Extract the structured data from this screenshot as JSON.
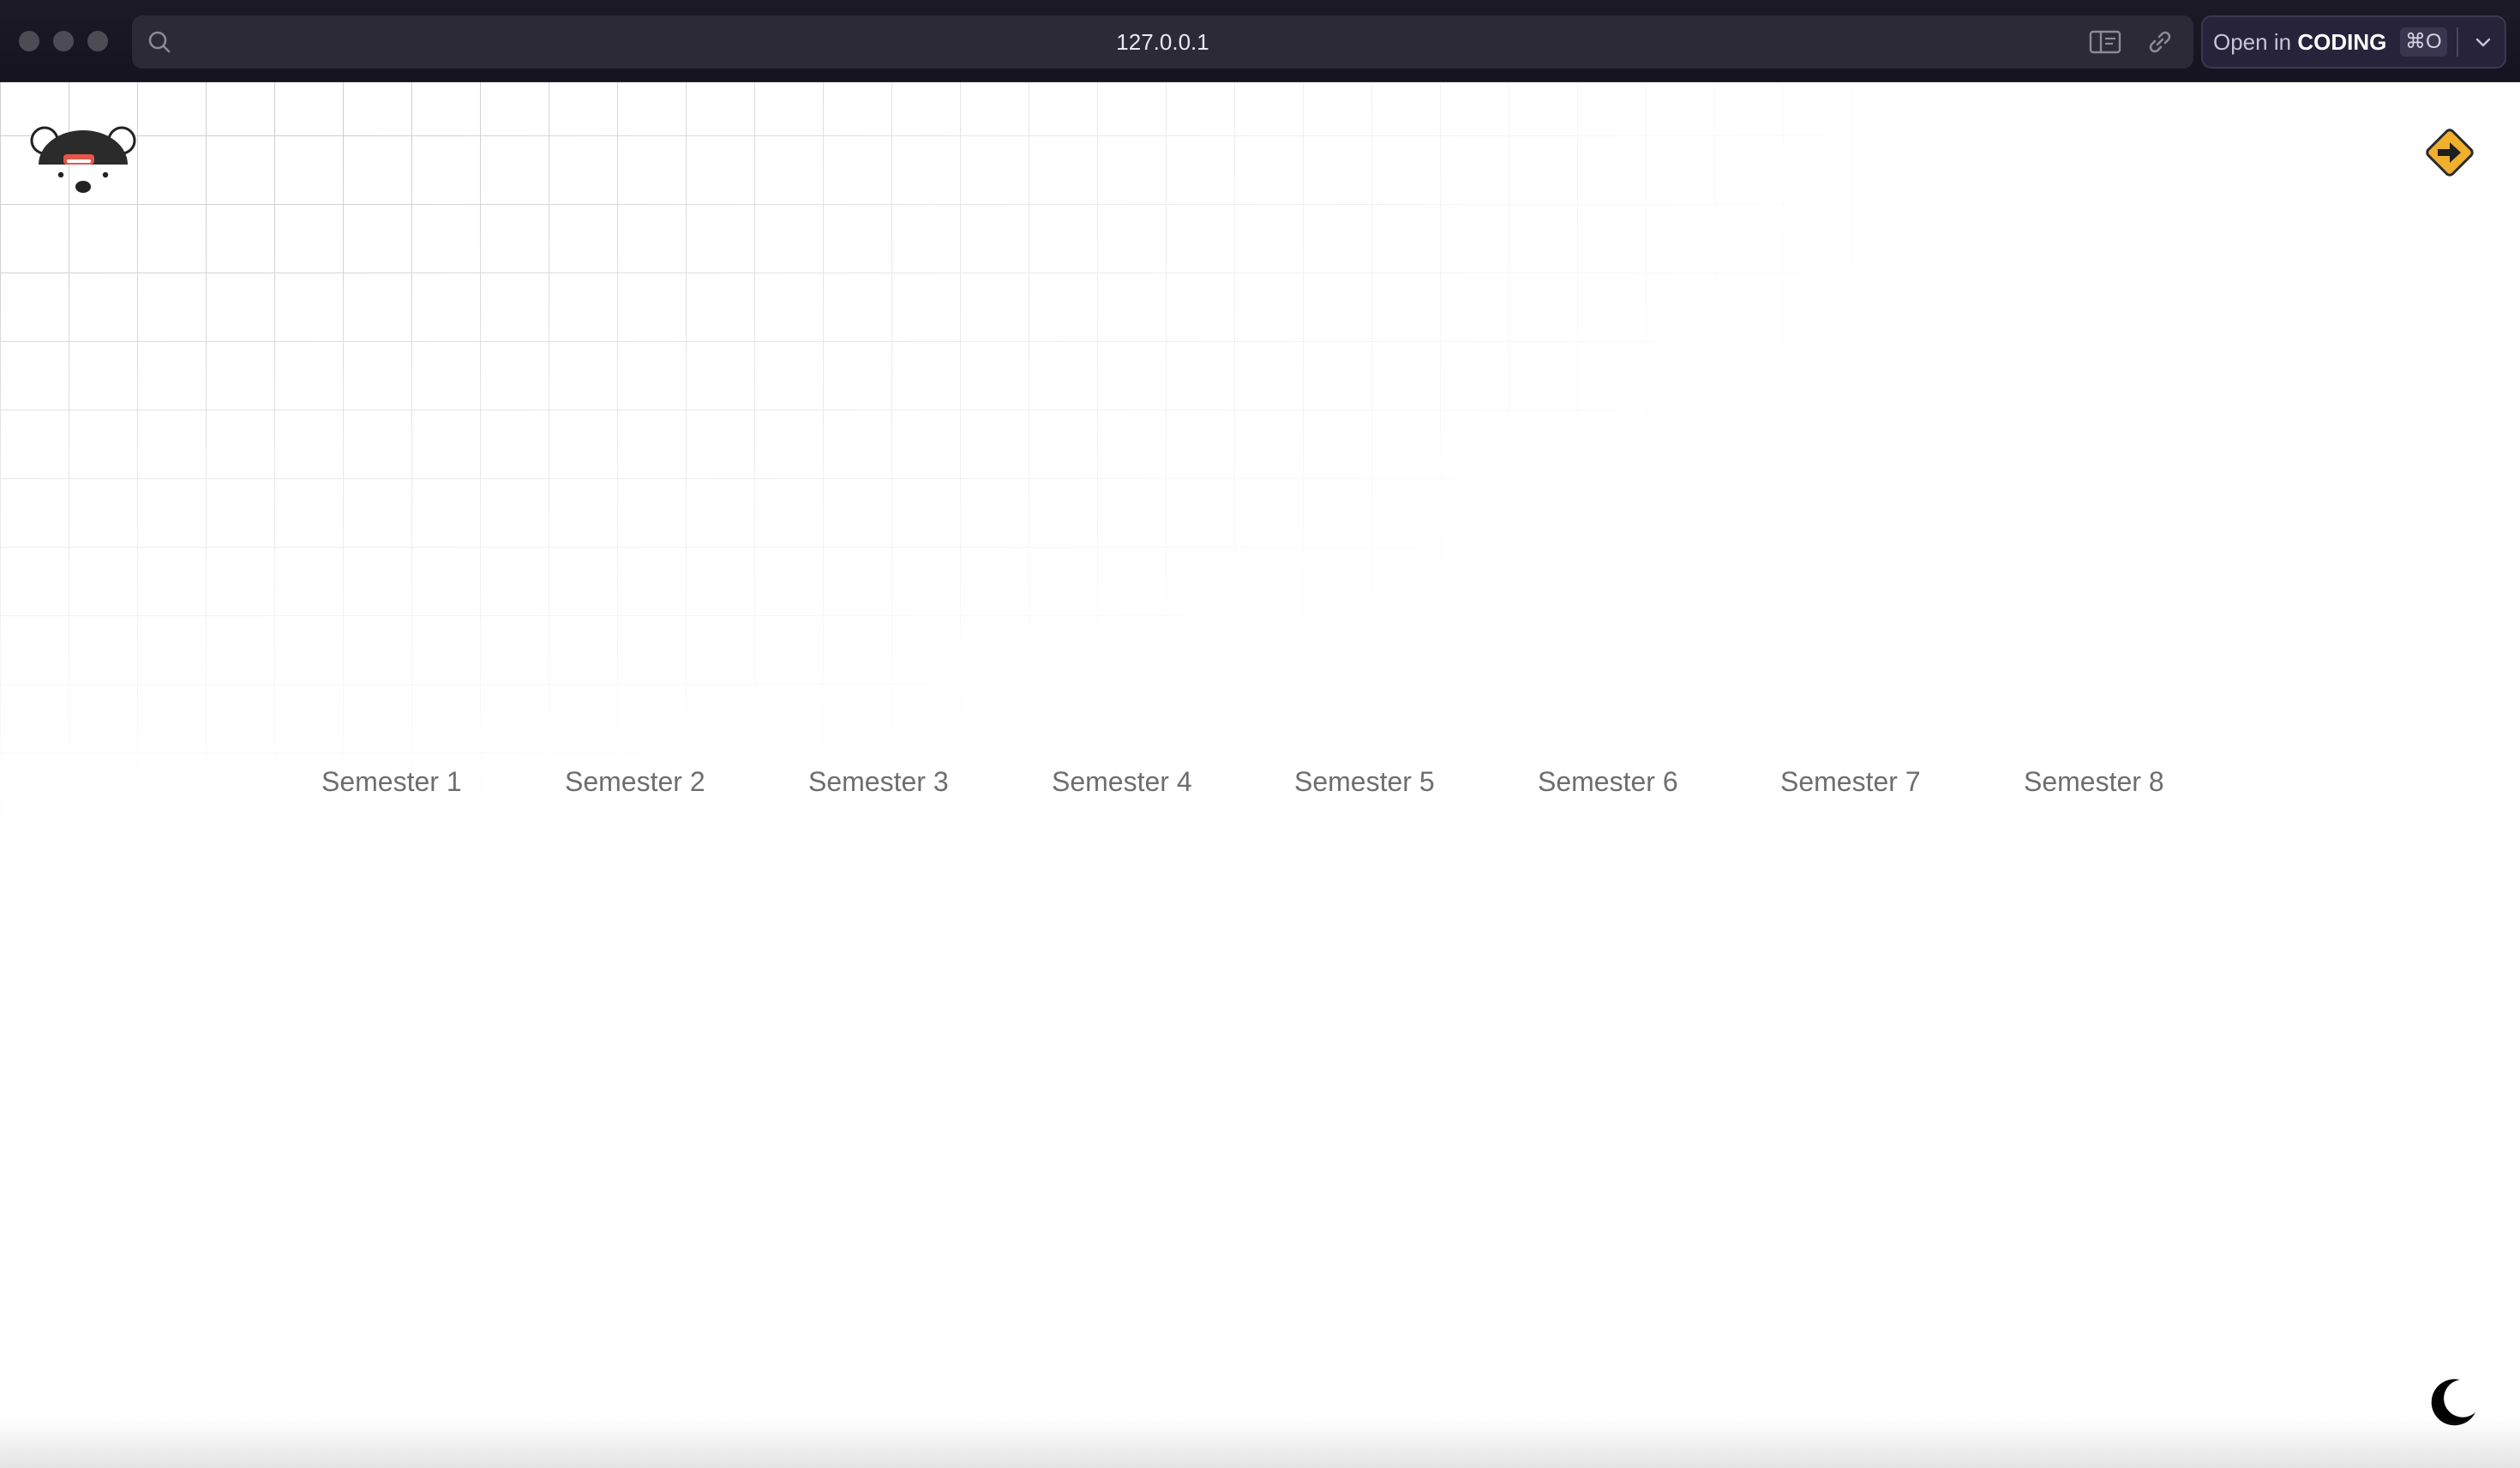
{
  "browser": {
    "url": "127.0.0.1",
    "open_in": {
      "prefix": "Open in",
      "app": "CODING",
      "shortcut": "⌘O"
    },
    "icons": {
      "search": "search-icon",
      "reader": "reader-mode-icon",
      "link": "link-icon",
      "chevron": "chevron-down-icon"
    }
  },
  "page": {
    "logo": "bear-logo",
    "corner_icon": "direction-sign-icon",
    "semesters": [
      "Semester 1",
      "Semester 2",
      "Semester 3",
      "Semester 4",
      "Semester 5",
      "Semester 6",
      "Semester 7",
      "Semester 8"
    ],
    "theme_toggle_icon": "moon-icon",
    "colors": {
      "sign": "#f0b02e",
      "logo_accent": "#e8544a",
      "semester_text": "#6e6e6e"
    }
  }
}
